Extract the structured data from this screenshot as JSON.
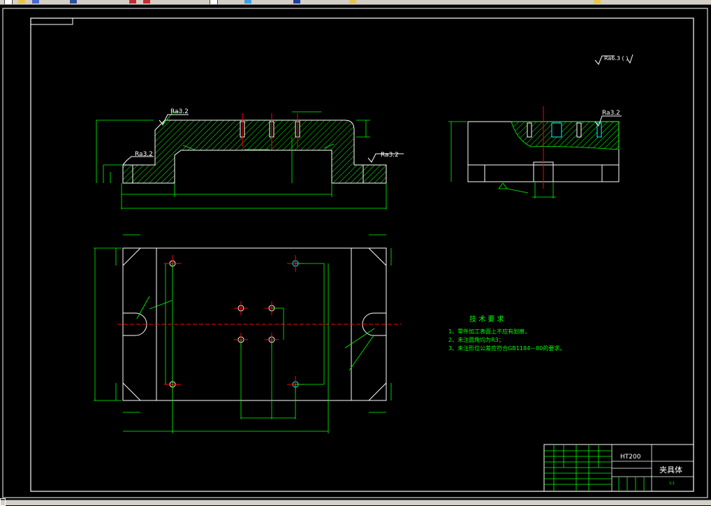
{
  "toolbar": {
    "icons": [
      "new-icon",
      "open-icon",
      "save-icon",
      "plot-icon",
      "undo-icon",
      "redo-icon",
      "pan-icon",
      "zoom-icon",
      "properties-icon",
      "layer-icon",
      "help-icon"
    ]
  },
  "drawing": {
    "colors": {
      "outline": "#ffffff",
      "dimension": "#00ff00",
      "center": "#ff0000",
      "hatch": "#00ff00",
      "cyan": "#00ffff"
    },
    "roughness_labels": [
      "Ra3.2",
      "Ra3.2",
      "Ra3.2",
      "Ra3.2"
    ],
    "top_note": "Ra6.3 (   )",
    "tech_requirements": {
      "title": "技 术 要 求",
      "items": [
        "1、零件加工表面上不应有划痕，",
        "2、未注圆角均为R3；",
        "3、未注形位公差应符合GB1184－80的要求。"
      ]
    },
    "title_block": {
      "material": "HT200",
      "part_name": "夹具体",
      "scale": "1:1"
    }
  }
}
